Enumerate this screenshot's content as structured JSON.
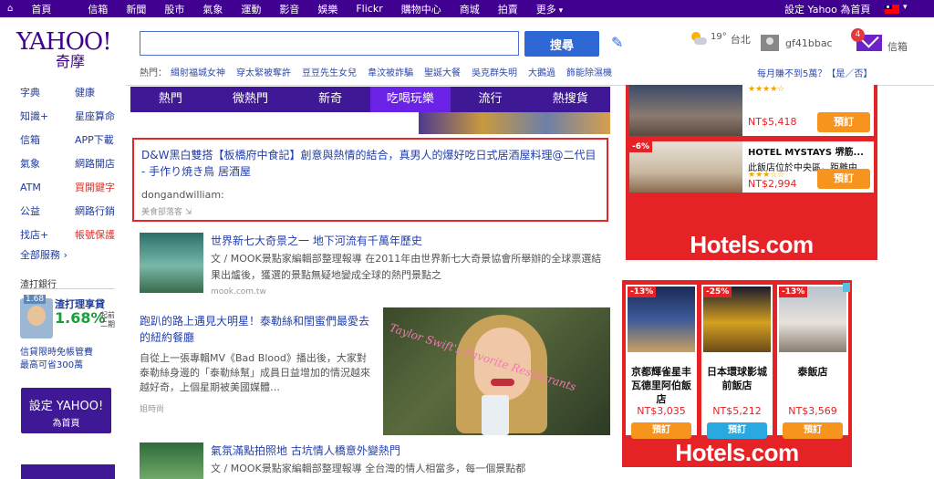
{
  "topbar": {
    "nav": [
      "首頁",
      "信箱",
      "新聞",
      "股市",
      "氣象",
      "運動",
      "影音",
      "娛樂",
      "Flickr",
      "購物中心",
      "商城",
      "拍賣",
      "更多"
    ],
    "sethome": "設定 Yahoo 為首頁"
  },
  "header": {
    "logo": "YAHOO!",
    "logo_zh": "奇摩",
    "search_value": "",
    "search_button": "搜尋",
    "hot_label": "熱門：",
    "hot_links": [
      "緝射福城女神",
      "穿太緊被奪許",
      "豆豆先生女兒",
      "韋汶被詐騙",
      "聖誕大餐",
      "吳克群失明",
      "大鵝過",
      "飾能除濕機"
    ],
    "weather_temp": "19°",
    "weather_city": "台北",
    "username": "gf41bbac",
    "mail_count": "4",
    "mail_label": "信箱",
    "rain_question": "每月賺不到5萬？【是／否】"
  },
  "sidebar": {
    "rows": [
      [
        "字典",
        "健康"
      ],
      [
        "知識+",
        "星座算命"
      ],
      [
        "信箱",
        "APP下載"
      ],
      [
        "氣象",
        "網路開店"
      ],
      [
        "ATM",
        "買開鍵字"
      ],
      [
        "公益",
        "網路行銷"
      ],
      [
        "找店+",
        "帳號保護"
      ]
    ],
    "more": "全部服務 ›",
    "bank_title": "渣打銀行",
    "bank_rate_tag": "1.68",
    "bank_name": "渣打理享貸",
    "bank_pct": "1.68%",
    "bank_side": "起前二期",
    "bank_note1": "信貸限時免帳管費",
    "bank_note2": "最高可省300萬",
    "sethome_l1": "設定 YAHOO!",
    "sethome_l2": "為首頁"
  },
  "main": {
    "tabs": [
      "熱門",
      "微熱門",
      "新奇",
      "吃喝玩樂",
      "流行",
      "熱搜貨"
    ],
    "featured_title": "D&W黑白雙搭【板橋府中食記】創意與熱情的結合，真男人的爆好吃日式居酒屋料理@二代目 - 手作り焼き鳥 居酒屋",
    "featured_author": "dongandwilliam:",
    "featured_src": "美食部落客 ⇲",
    "story1_title": "世界新七大奇景之一 地下河流有千萬年歷史",
    "story1_desc": "文 / MOOK景點家編輯部整理報導 在2011年由世界新七大奇景協會所舉辦的全球票選結果出爐後，獲選的景點無疑地變成全球的熱門景點之",
    "story1_src": "mook.com.tw",
    "story2_title": "跑趴的路上遇見大明星！泰勒絲和閨蜜們最愛去的紐約餐廳",
    "story2_desc": "自從上一張專輯MV《Bad Blood》播出後，大家對泰勒絲身邊的「泰勒絲幫」成員日益增加的情況越來越好奇，上個星期被美國媒體…",
    "story2_src": "姐時尚",
    "taylor_caption": "Taylor Swift's Favorite Restaurants",
    "story3_title": "氣氛滿點拍照地 古坑情人橋意外變熱門",
    "story3_desc": "文 / MOOK景點家編輯部整理報導 全台灣的情人相當多，每一個景點都"
  },
  "ads": {
    "top_cards": [
      {
        "tag": "",
        "name": "",
        "sub": "",
        "stars": "★★★★☆",
        "price": "NT$5,418",
        "book": "預訂"
      },
      {
        "tag": "-6%",
        "name": "HOTEL MYSTAYS 堺筋...",
        "sub": "此飯店位於中央區，距離中...",
        "stars": "★★★☆☆",
        "price": "NT$2,994",
        "book": "預訂"
      }
    ],
    "brand": "Hotels.com",
    "bottom_cards": [
      {
        "tag": "-13%",
        "name": "京都輝雀星丰瓦德里阿伯飯店",
        "price": "NT$3,035",
        "book": "預訂"
      },
      {
        "tag": "-25%",
        "name": "日本環球影城前飯店",
        "price": "NT$5,212",
        "book": "預訂"
      },
      {
        "tag": "-13%",
        "name": "泰飯店",
        "price": "NT$3,569",
        "book": "預訂"
      }
    ],
    "colors": {
      "brand_red": "#e52327",
      "book_orange": "#f7941d",
      "book_blue": "#29a9e0",
      "yahoo_purple": "#400090"
    }
  }
}
